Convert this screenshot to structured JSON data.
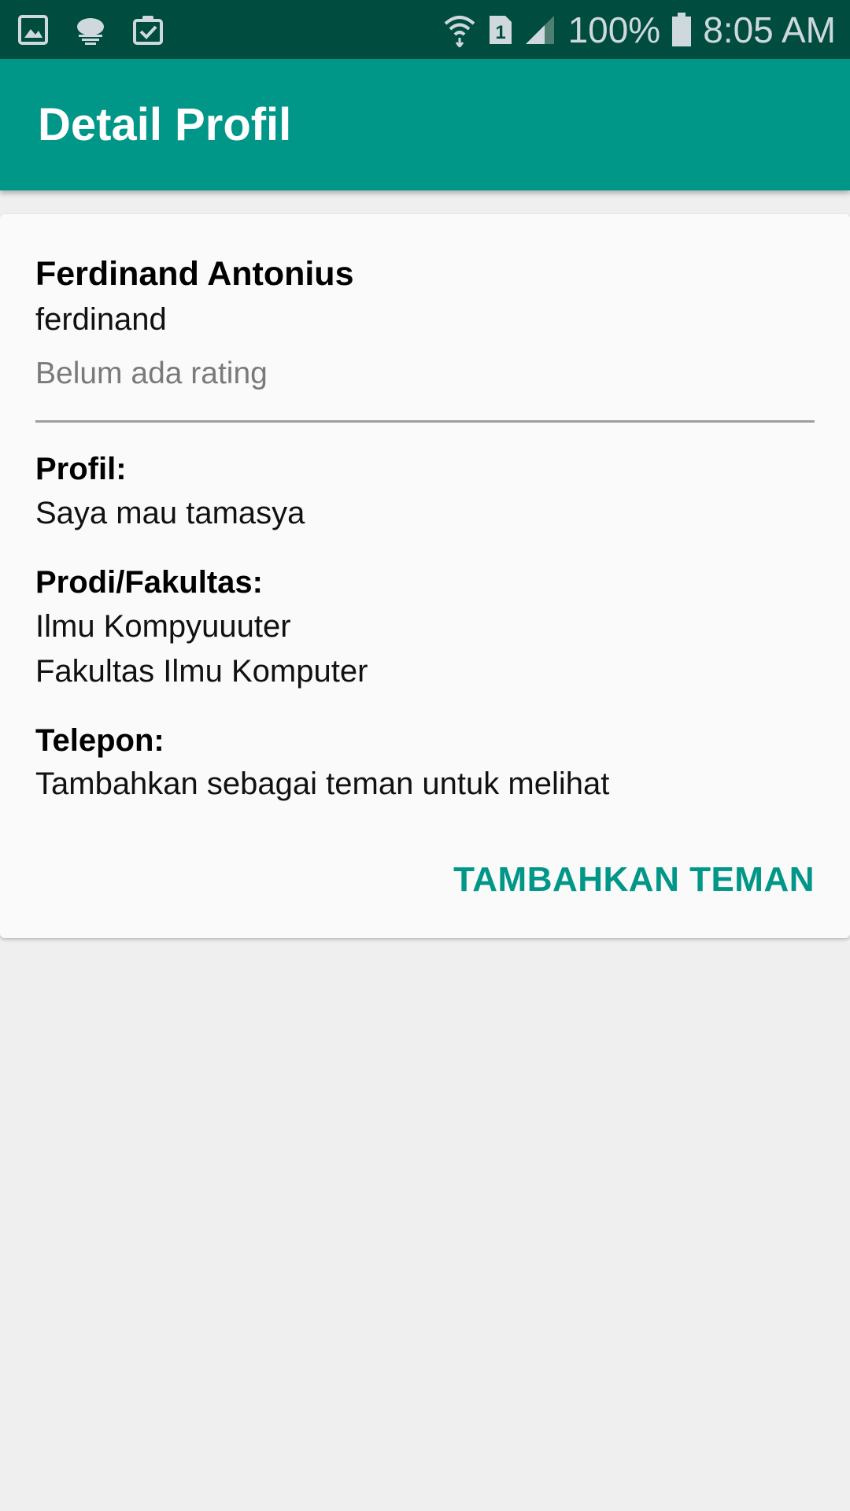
{
  "status_bar": {
    "battery": "100%",
    "time": "8:05 AM",
    "sim_slot": "1",
    "icons": [
      "gallery-icon",
      "cloud-icon",
      "clipboard-check-icon",
      "wifi-icon",
      "sim-icon",
      "signal-icon",
      "battery-icon"
    ]
  },
  "app_bar": {
    "title": "Detail Profil",
    "color": "#009688"
  },
  "profile": {
    "name": "Ferdinand Antonius",
    "username": "ferdinand",
    "rating": "Belum ada rating",
    "profile_label": "Profil:",
    "profile_value": "Saya mau tamasya",
    "faculty_label": "Prodi/Fakultas:",
    "program": "Ilmu Kompyuuuter",
    "faculty": "Fakultas Ilmu Komputer",
    "phone_label": "Telepon:",
    "phone_value": "Tambahkan sebagai teman untuk melihat"
  },
  "actions": {
    "add_friend": "TAMBAHKAN TEMAN"
  },
  "colors": {
    "status_bar": "#004d40",
    "accent": "#009688",
    "background": "#efefef"
  }
}
